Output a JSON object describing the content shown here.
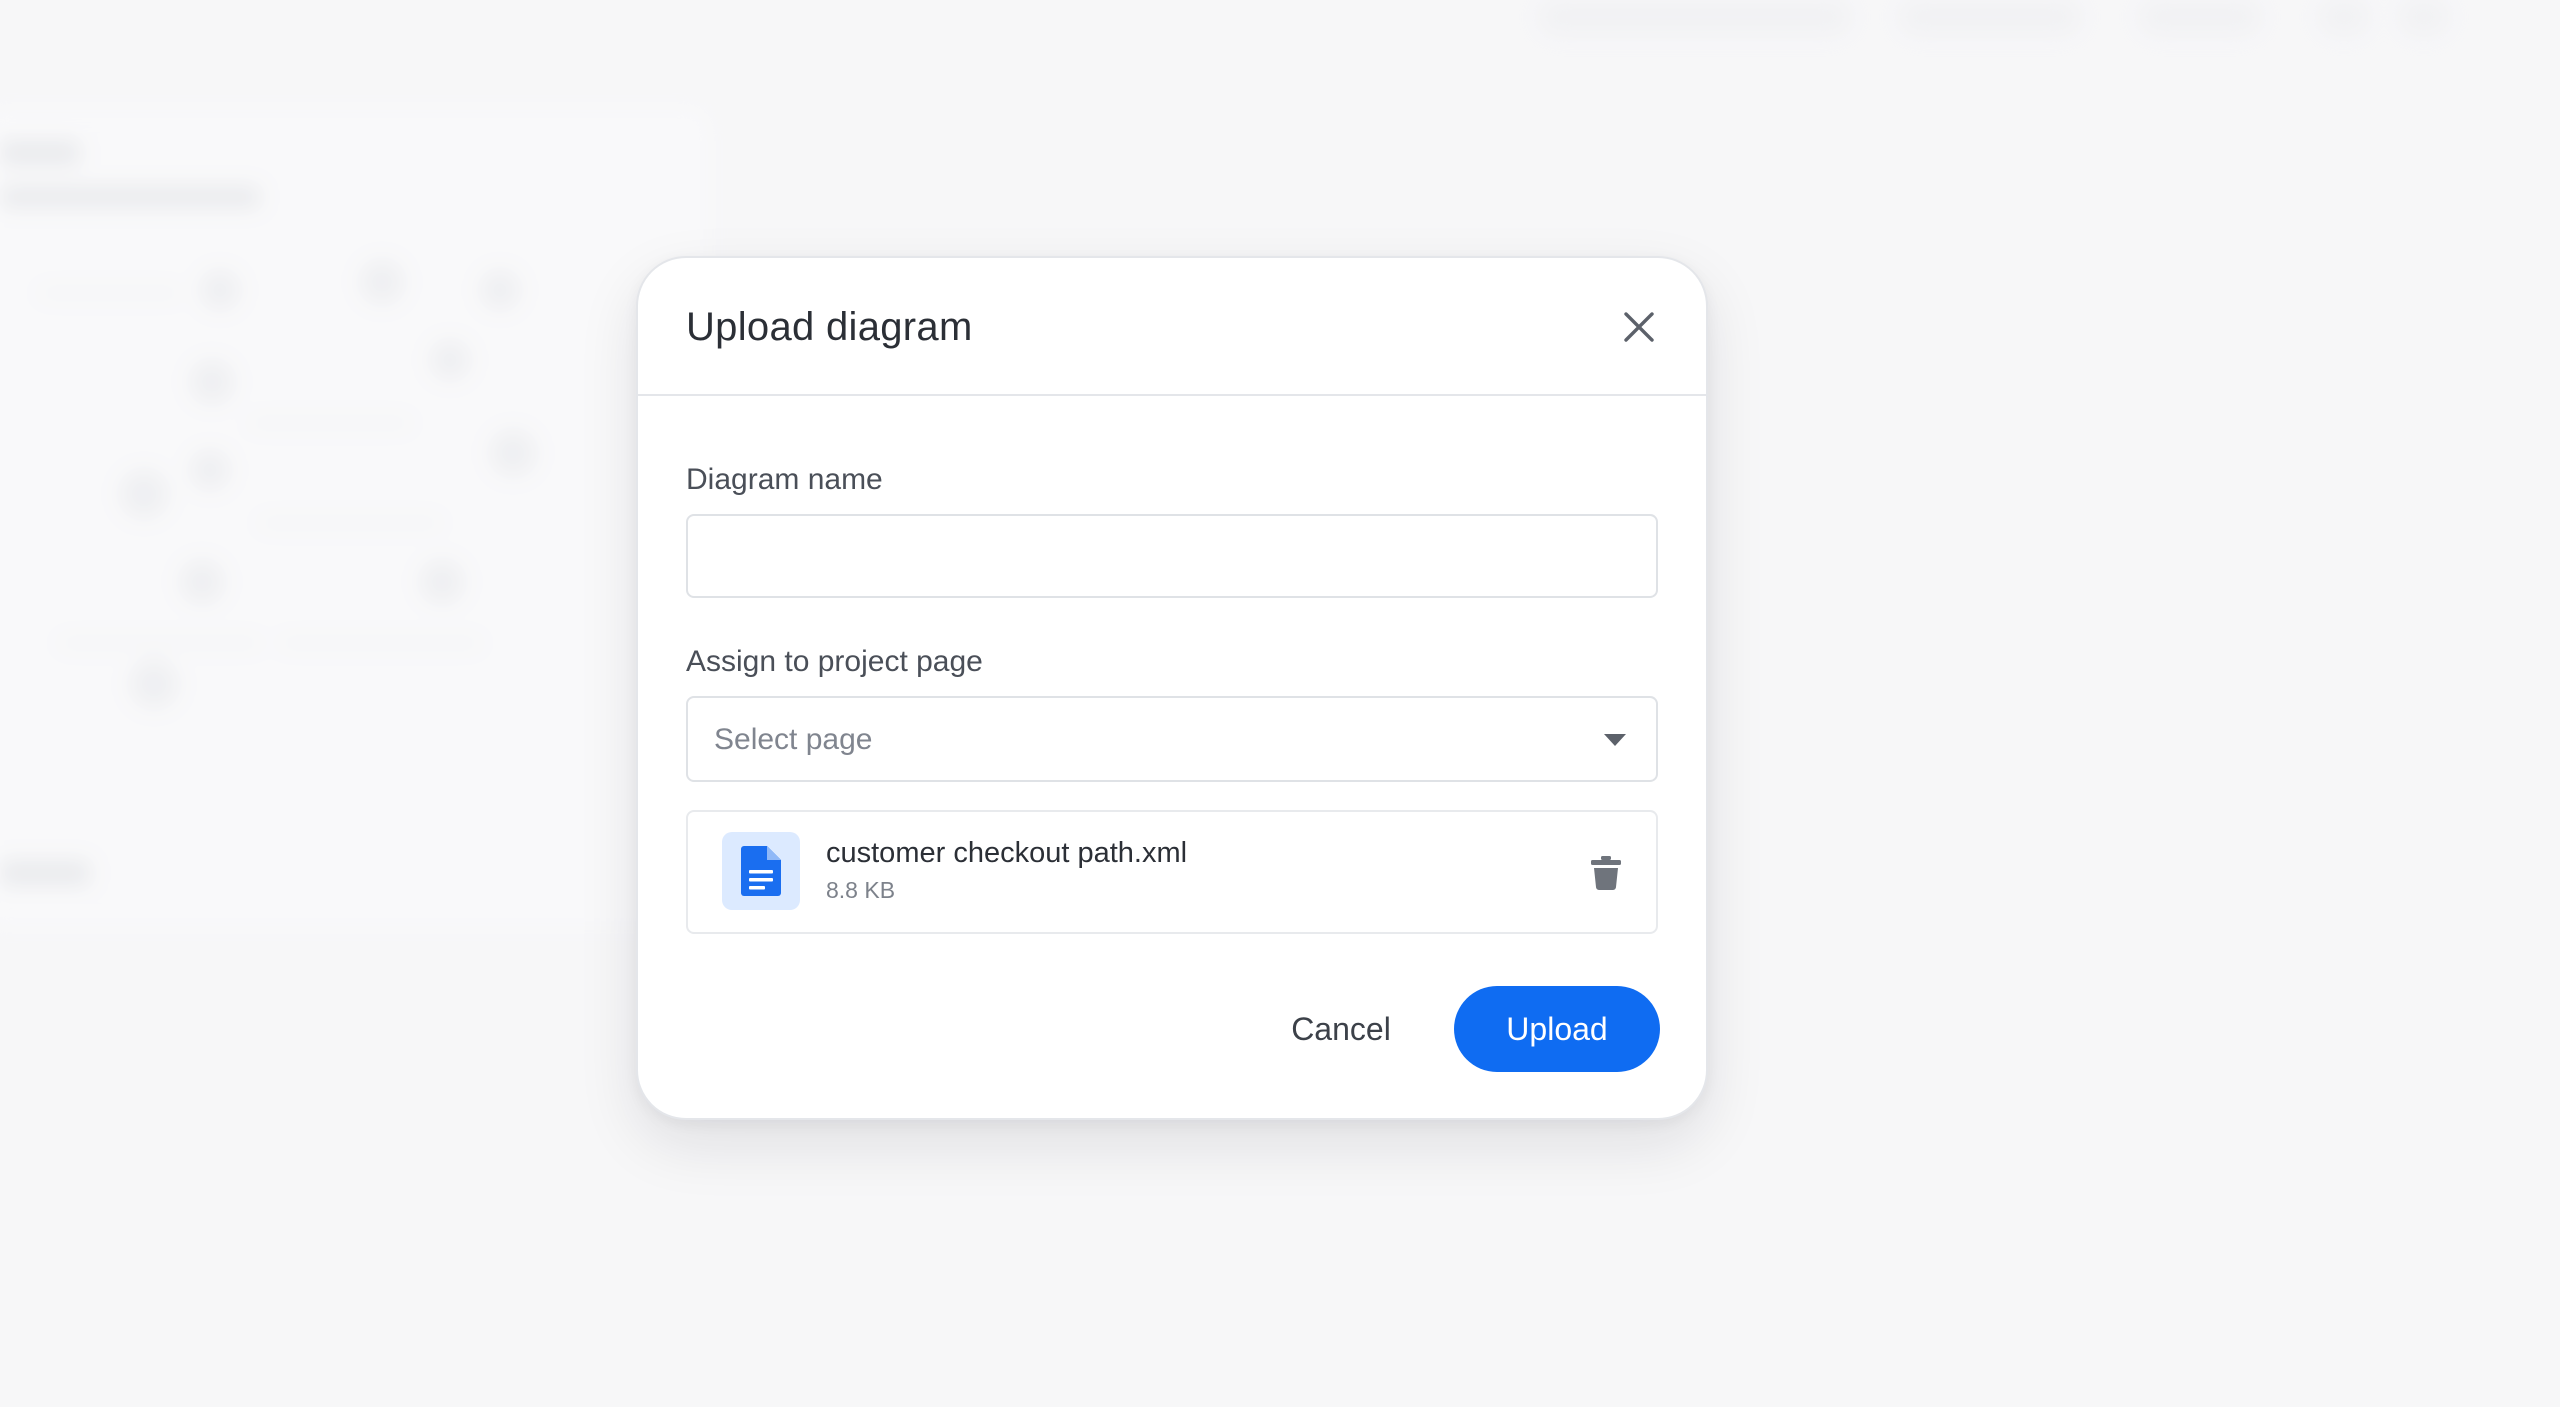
{
  "dialog": {
    "title": "Upload diagram",
    "name_label": "Diagram name",
    "name_value": "",
    "page_label": "Assign to project page",
    "page_placeholder": "Select page",
    "file": {
      "name": "customer checkout path.xml",
      "size": "8.8 KB"
    },
    "cancel_label": "Cancel",
    "upload_label": "Upload"
  },
  "icons": {
    "close": "close-icon",
    "dropdown": "chevron-down-icon",
    "file": "document-icon",
    "delete": "trash-icon"
  },
  "colors": {
    "accent": "#0f6cf2",
    "file_icon_bg": "#dceaff",
    "backdrop": "#f7f7f8"
  }
}
